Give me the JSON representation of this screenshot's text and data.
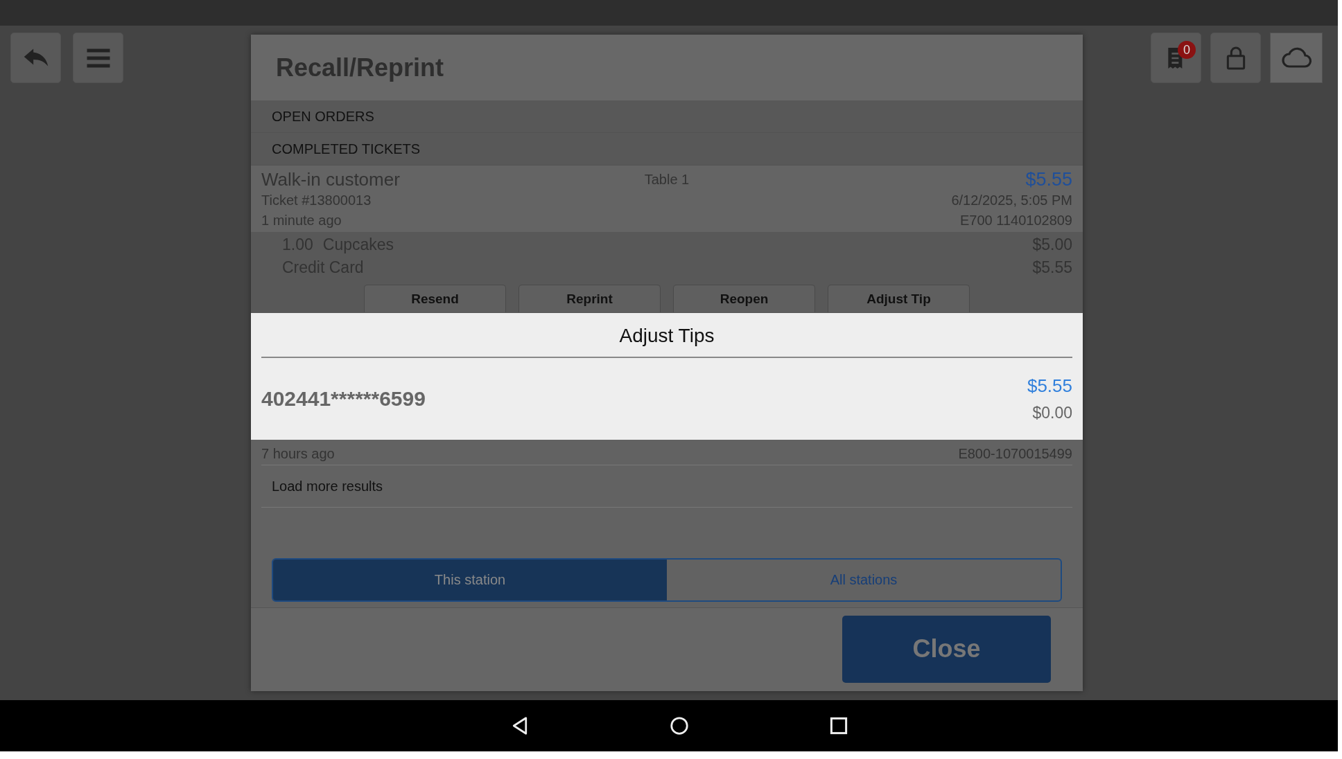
{
  "top_bar": {
    "receipt_badge": "0"
  },
  "header": {
    "title": "Recall/Reprint"
  },
  "sections": [
    {
      "label": "OPEN ORDERS"
    },
    {
      "label": "COMPLETED TICKETS"
    }
  ],
  "ticket": {
    "customer": "Walk-in customer",
    "table": "Table 1",
    "total": "$5.55",
    "number": "Ticket #13800013",
    "datetime": "6/12/2025, 5:05 PM",
    "age": "1 minute ago",
    "device": "E700 1140102809",
    "lines": [
      {
        "kind": "item",
        "qty": "1.00",
        "name": "Cupcakes",
        "amount": "$5.00"
      },
      {
        "kind": "payment",
        "name": "Credit Card",
        "amount": "$5.55"
      }
    ],
    "actions": [
      "Resend",
      "Reprint",
      "Reopen",
      "Adjust Tip"
    ]
  },
  "next_ticket": {
    "age": "7 hours ago",
    "device": "E800-1070015499"
  },
  "load_more": "Load more results",
  "station_toggle": [
    {
      "label": "This station",
      "selected": true
    },
    {
      "label": "All stations",
      "selected": false
    }
  ],
  "close_button": "Close",
  "dialog": {
    "title": "Adjust Tips",
    "card": "402441******6599",
    "amount": "$5.55",
    "tip": "$0.00"
  }
}
